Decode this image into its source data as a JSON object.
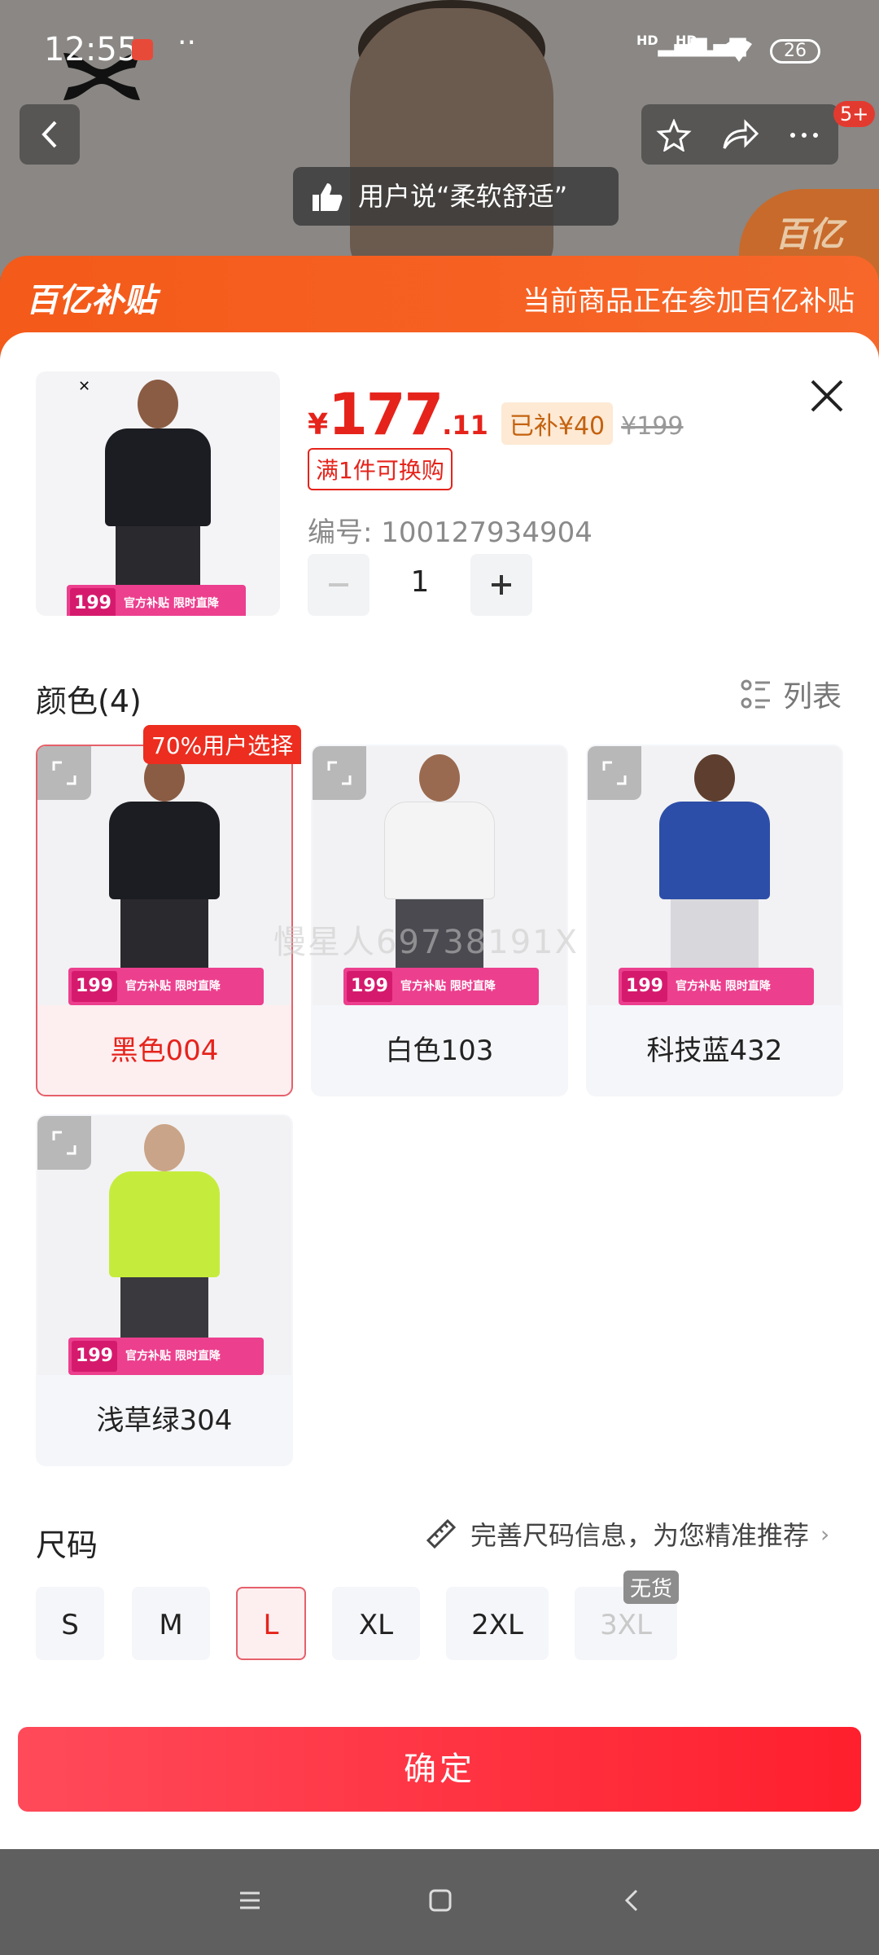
{
  "status_bar": {
    "time": "12:55",
    "dots": "··",
    "signal_1": "HD",
    "signal_2": "HD",
    "battery": "26"
  },
  "header": {
    "notification_count": "5+",
    "review_text": "用户说“柔软舒适”",
    "badge_text": "百亿"
  },
  "subsidy": {
    "logo": "百亿补贴",
    "text": "当前商品正在参加百亿补贴"
  },
  "product": {
    "currency": "¥",
    "price_int": "177",
    "price_dec": ".11",
    "subsidy_label": "已补¥40",
    "original_price": "¥199",
    "promo_tag": "满1件可换购",
    "sku_label": "编号: 100127934904",
    "quantity": "1"
  },
  "colors": {
    "title": "颜色(4)",
    "list_toggle": "列表",
    "choice_badge": "70%用户选择",
    "banner_price": "199",
    "banner_text": "官方补贴 限时直降",
    "brand_mark": "✕",
    "items": [
      {
        "label": "黑色004",
        "selected": true,
        "shirt": "#1c1d22"
      },
      {
        "label": "白色103",
        "selected": false,
        "shirt": "#f4f4f4"
      },
      {
        "label": "科技蓝432",
        "selected": false,
        "shirt": "#2d4ea8"
      },
      {
        "label": "浅草绿304",
        "selected": false,
        "shirt": "#c5ec3c"
      }
    ]
  },
  "watermark": "慢星人69738191X",
  "sizes": {
    "title": "尺码",
    "hint": "完善尺码信息，为您精准推荐",
    "stock_badge": "无货",
    "items": [
      {
        "label": "S",
        "state": "normal"
      },
      {
        "label": "M",
        "state": "normal"
      },
      {
        "label": "L",
        "state": "selected"
      },
      {
        "label": "XL",
        "state": "normal"
      },
      {
        "label": "2XL",
        "state": "normal"
      },
      {
        "label": "3XL",
        "state": "disabled"
      }
    ]
  },
  "confirm_label": "确定",
  "accent_color": "#e5231b"
}
